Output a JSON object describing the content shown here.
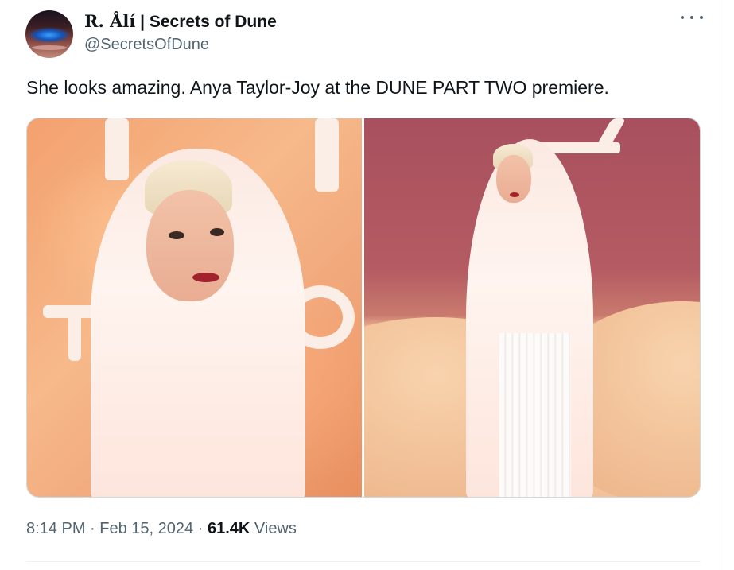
{
  "tweet": {
    "display_name_prefix": "R. Ålí",
    "display_name_rest": " | Secrets of Dune",
    "handle": "@SecretsOfDune",
    "text": "She looks amazing. Anya Taylor-Joy at the DUNE PART TWO premiere.",
    "time": "8:14 PM",
    "separator": "·",
    "date": "Feb 15, 2024",
    "views_count": "61.4K",
    "views_label": "Views"
  },
  "icons": {
    "more": "more-horizontal-icon"
  },
  "colors": {
    "text_primary": "#0f1419",
    "text_secondary": "#536471",
    "border": "#cfd9de"
  }
}
